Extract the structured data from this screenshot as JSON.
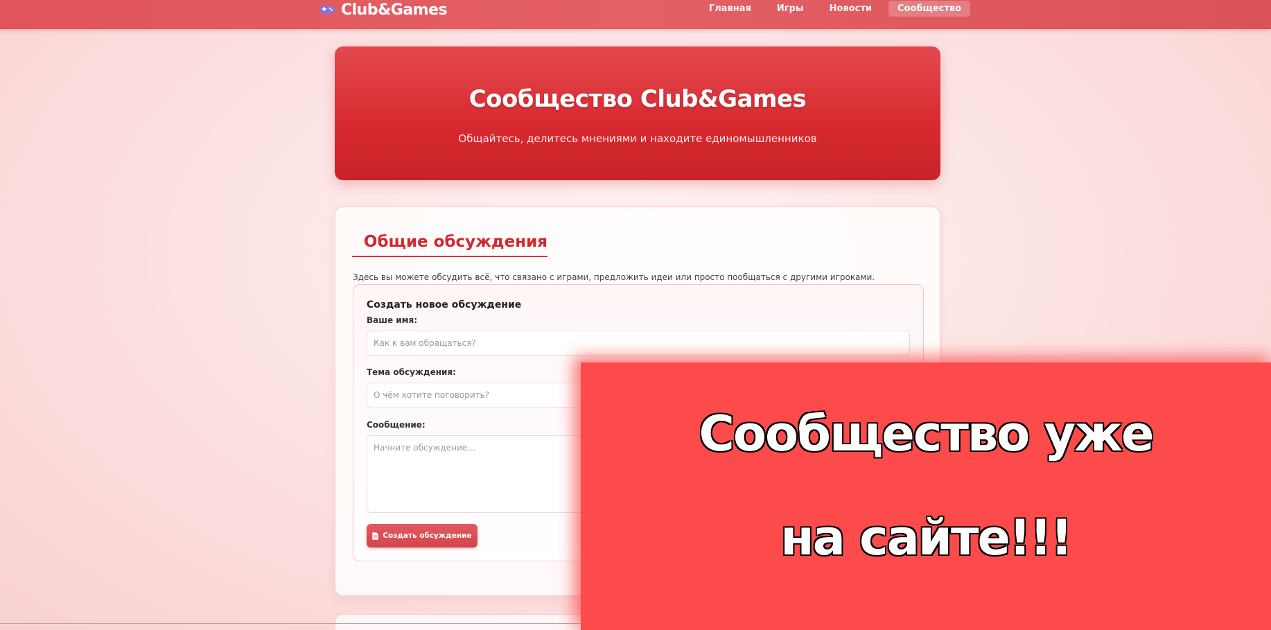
{
  "navbar": {
    "brand": "Club&Games",
    "brand_icon": "gamepad-icon",
    "links": [
      {
        "label": "Главная",
        "active": false
      },
      {
        "label": "Игры",
        "active": false
      },
      {
        "label": "Новости",
        "active": false
      },
      {
        "label": "Сообщество",
        "active": true
      }
    ]
  },
  "hero": {
    "title": "Сообщество Club&Games",
    "subtitle": "Общайтесь, делитесь мнениями и находите единомышленников"
  },
  "section": {
    "icon": "speech-bubble-icon",
    "title": "Общие обсуждения",
    "description": "Здесь вы можете обсудить всё, что связано с играми, предложить идеи или просто пообщаться с другими игроками."
  },
  "form": {
    "title": "Создать новое обсуждение",
    "name_label": "Ваше имя:",
    "name_placeholder": "Как к вам обращаться?",
    "name_value": "",
    "topic_label": "Тема обсуждения:",
    "topic_placeholder": "О чём хотите поговорить?",
    "topic_value": "",
    "message_label": "Сообщение:",
    "message_placeholder": "Начните обсуждение...",
    "message_value": "",
    "submit_icon": "document-icon",
    "submit_label": "Создать обсуждение"
  },
  "promo": {
    "line1": "Сообщество уже",
    "line2": "на сайте!!!"
  },
  "colors": {
    "accent": "#d9383e",
    "nav_bg": "#e0555a",
    "promo_bg": "#fd4b4b"
  }
}
